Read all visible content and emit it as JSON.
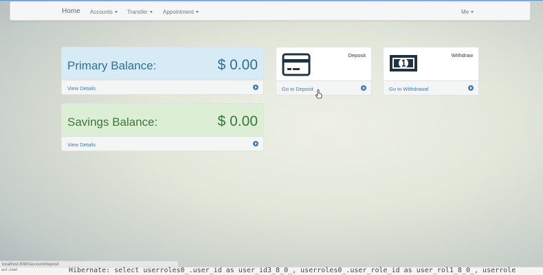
{
  "navbar": {
    "brand": "Home",
    "items": [
      "Accounts",
      "Transfer",
      "Appointment"
    ],
    "user_menu": "Me"
  },
  "accounts": [
    {
      "label": "Primary Balance:",
      "amount": "$ 0.00",
      "link": "View Details"
    },
    {
      "label": "Savings Balance:",
      "amount": "$ 0.00",
      "link": "View Details"
    }
  ],
  "actions": [
    {
      "title": "Deposit",
      "link": "Go to Deposit",
      "icon": "credit-card-icon"
    },
    {
      "title": "Withdraw",
      "link": "Go to Withdrawal",
      "icon": "banknote-icon"
    }
  ],
  "colors": {
    "primary_text": "#31708f",
    "primary_bg": "#d9edf6",
    "savings_text": "#3c763d",
    "savings_bg": "#dff0d8",
    "link": "#3f7bbf",
    "icon": "#1f3345"
  },
  "status_bar": {
    "url": "localhost:8080/account/deposit"
  },
  "console": {
    "file": "unt.html",
    "log": "Hibernate: select userroles0_.user_id as user_id3_8_0_, userroles0_.user_role_id as user_rol1_8_0_, userrole"
  }
}
